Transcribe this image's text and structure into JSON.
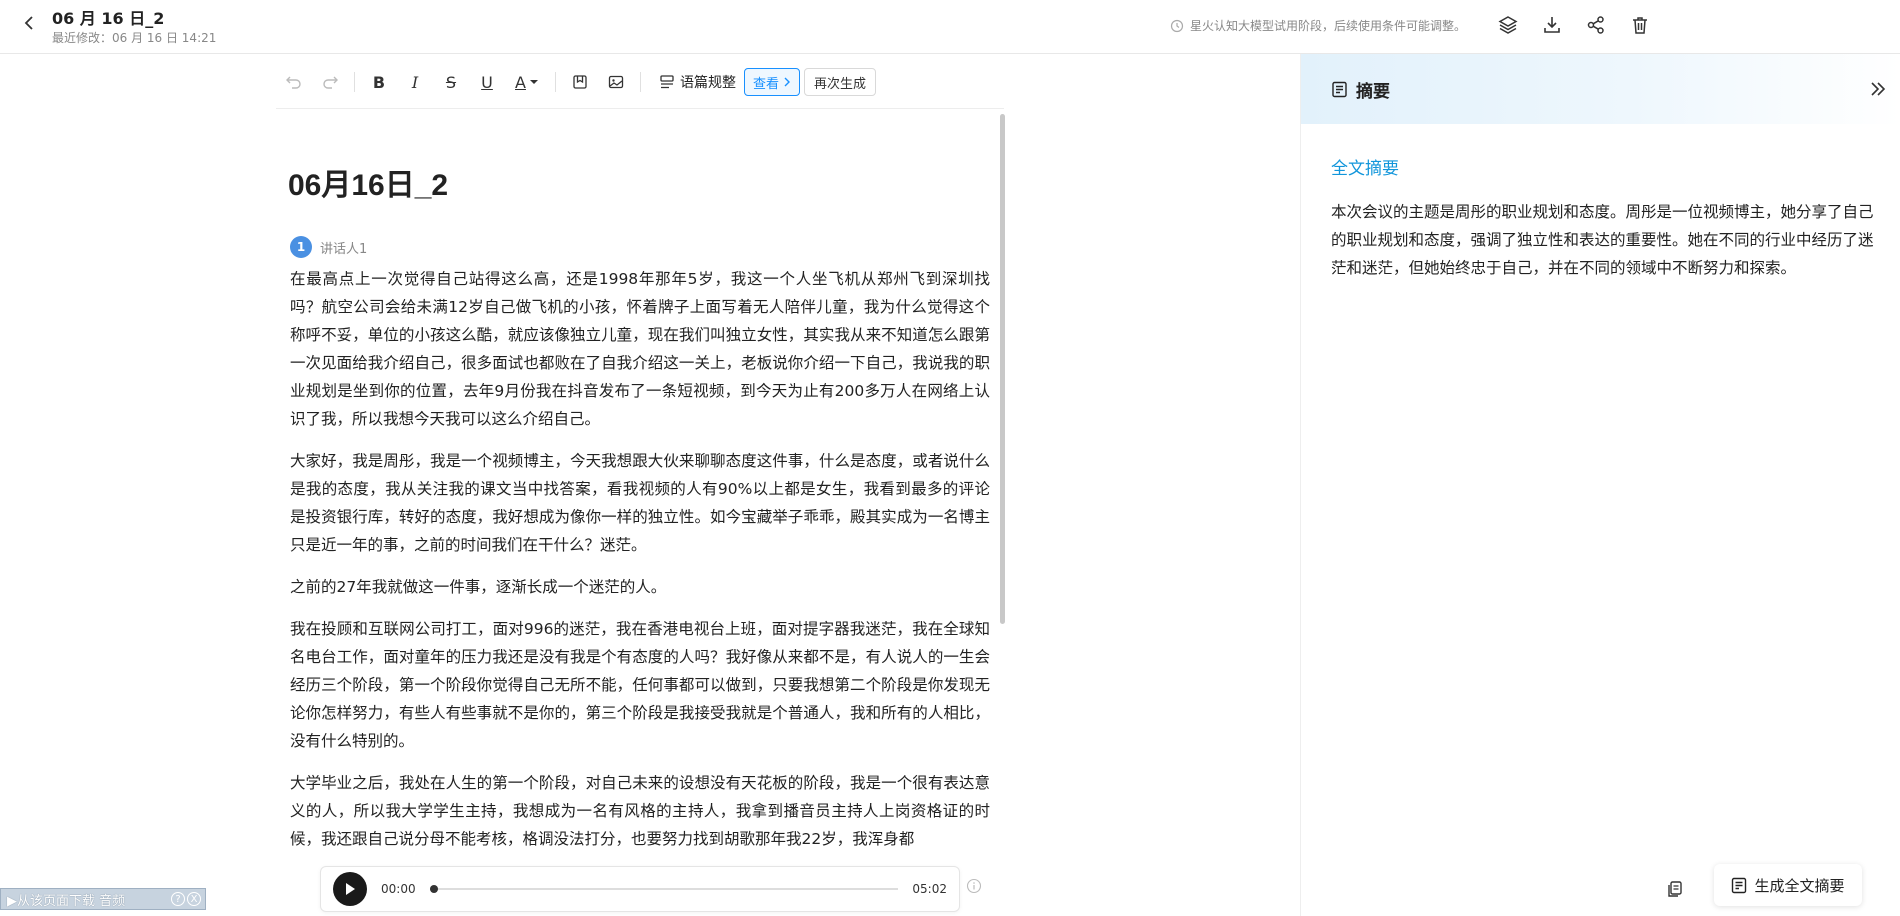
{
  "header": {
    "title": "06 月 16 日_2",
    "last_modified": "最近修改：06 月 16 日 14:21",
    "notice": "星火认知大模型试用阶段，后续使用条件可能调整。",
    "icons": [
      "layers-icon",
      "download-icon",
      "share-icon",
      "delete-icon"
    ]
  },
  "toolbar": {
    "undo_icon": "undo-icon",
    "redo_icon": "redo-icon",
    "bold": "B",
    "italic": "I",
    "strike": "S",
    "underline": "U",
    "font_color": "A",
    "outline_label": "语篇规整",
    "view_label": "查看",
    "regen_label": "再次生成"
  },
  "document": {
    "heading": "06月16日_2",
    "speaker_number": "1",
    "speaker_name": "讲话人1",
    "paragraphs": [
      "在最高点上一次觉得自己站得这么高，还是1998年那年5岁，我这一个人坐飞机从郑州飞到深圳找吗？航空公司会给未满12岁自己做飞机的小孩，怀着牌子上面写着无人陪伴儿童，我为什么觉得这个称呼不妥，单位的小孩这么酷，就应该像独立儿童，现在我们叫独立女性，其实我从来不知道怎么跟第一次见面给我介绍自己，很多面试也都败在了自我介绍这一关上，老板说你介绍一下自己，我说我的职业规划是坐到你的位置，去年9月份我在抖音发布了一条短视频，到今天为止有200多万人在网络上认识了我，所以我想今天我可以这么介绍自己。",
      "大家好，我是周彤，我是一个视频博主，今天我想跟大伙来聊聊态度这件事，什么是态度，或者说什么是我的态度，我从关注我的课文当中找答案，看我视频的人有90%以上都是女生，我看到最多的评论是投资银行库，转好的态度，我好想成为像你一样的独立性。如今宝藏举子乖乖，殿其实成为一名博主只是近一年的事，之前的时间我们在干什么？迷茫。",
      "之前的27年我就做这一件事，逐渐长成一个迷茫的人。",
      "我在投顾和互联网公司打工，面对996的迷茫，我在香港电视台上班，面对提字器我迷茫，我在全球知名电台工作，面对童年的压力我还是没有我是个有态度的人吗？我好像从来都不是，有人说人的一生会经历三个阶段，第一个阶段你觉得自己无所不能，任何事都可以做到，只要我想第二个阶段是你发现无论你怎样努力，有些人有些事就不是你的，第三个阶段是我接受我就是个普通人，我和所有的人相比，没有什么特别的。",
      "大学毕业之后，我处在人生的第一个阶段，对自己未来的设想没有天花板的阶段，我是一个很有表达意义的人，所以我大学学生主持，我想成为一名有风格的主持人，我拿到播音员主持人上岗资格证的时候，我还跟自己说分母不能考核，格调没法打分，也要努力找到胡歌那年我22岁，我浑身都"
    ]
  },
  "player": {
    "current_time": "00:00",
    "duration": "05:02",
    "progress": 0
  },
  "download_bar": {
    "label": "▶从该页面下载 音频",
    "help": "?",
    "close": "X"
  },
  "summary": {
    "title": "摘要",
    "section_label": "全文摘要",
    "text": "本次会议的主题是周彤的职业规划和态度。周彤是一位视频博主，她分享了自己的职业规划和态度，强调了独立性和表达的重要性。她在不同的行业中经历了迷茫和迷茫，但她始终忠于自己，并在不同的领域中不断努力和探索。",
    "generate_label": "生成全文摘要"
  }
}
